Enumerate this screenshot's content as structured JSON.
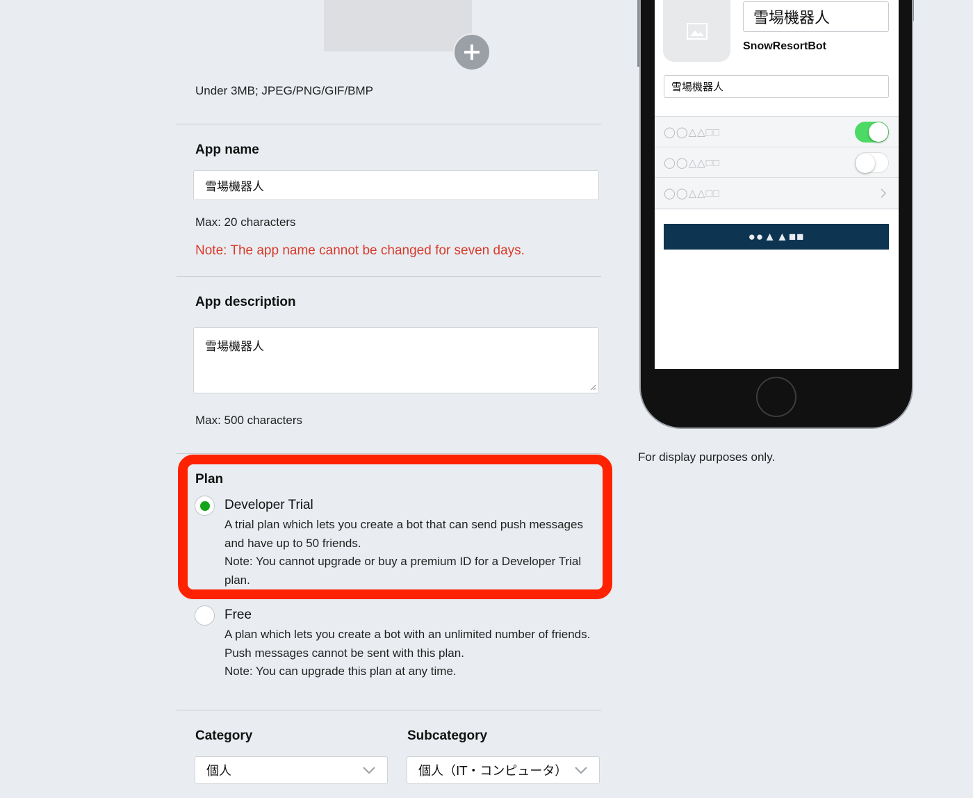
{
  "upload": {
    "hint": "Under 3MB; JPEG/PNG/GIF/BMP"
  },
  "app_name": {
    "label": "App name",
    "value": "雪場機器人",
    "max": "Max: 20 characters",
    "note": "Note: The app name cannot be changed for seven days."
  },
  "app_description": {
    "label": "App description",
    "value": "雪場機器人",
    "max": "Max: 500 characters"
  },
  "plan": {
    "label": "Plan",
    "options": [
      {
        "title": "Developer Trial",
        "selected": true,
        "lines": [
          "A trial plan which lets you create a bot that can send push messages",
          "and have up to 50 friends.",
          "Note: You cannot upgrade or buy a premium ID for a Developer Trial",
          "plan."
        ]
      },
      {
        "title": "Free",
        "selected": false,
        "lines": [
          "A plan which lets you create a bot with an unlimited number of friends.",
          "Push messages cannot be sent with this plan.",
          "Note: You can upgrade this plan at any time."
        ]
      }
    ]
  },
  "category": {
    "label": "Category",
    "value": "個人"
  },
  "subcategory": {
    "label": "Subcategory",
    "value": "個人（IT・コンピュータ）"
  },
  "preview": {
    "name": "雪場機器人",
    "bot_id": "SnowResortBot",
    "description": "雪場機器人",
    "rows": [
      {
        "label": "◯◯△△□□",
        "control": "toggle-on"
      },
      {
        "label": "◯◯△△□□",
        "control": "toggle-off"
      },
      {
        "label": "◯◯△△□□",
        "control": "chevron"
      }
    ],
    "button_label": "●●▲▲■■",
    "caption": "For display purposes only."
  },
  "colors": {
    "accent_green": "#14a61a",
    "note_red": "#d93a2b",
    "highlight_red": "#ff2200",
    "preview_button": "#0d3552",
    "toggle_on": "#4cd964"
  }
}
